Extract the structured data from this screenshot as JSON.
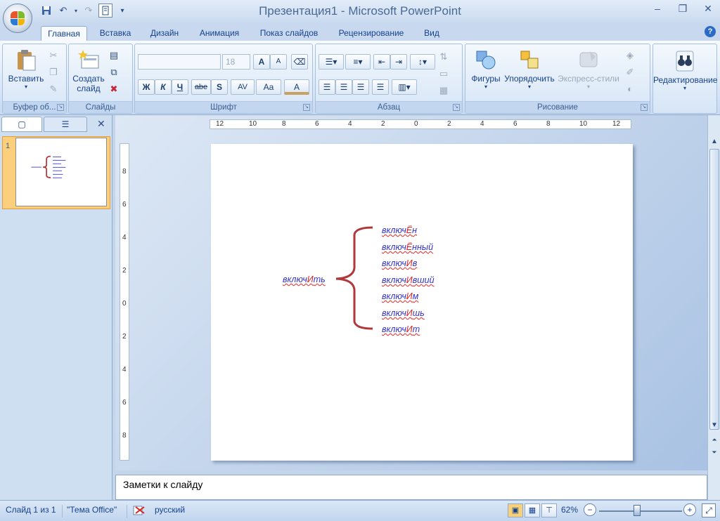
{
  "window": {
    "title": "Презентация1 - Microsoft PowerPoint",
    "minimize": "–",
    "restore": "❐",
    "close": "✕"
  },
  "quick_access": {
    "save_icon": "save-icon",
    "undo_icon": "undo-icon",
    "redo_icon": "redo-icon",
    "customize_icon": "customize-icon"
  },
  "tabs": [
    {
      "label": "Главная",
      "active": true
    },
    {
      "label": "Вставка"
    },
    {
      "label": "Дизайн"
    },
    {
      "label": "Анимация"
    },
    {
      "label": "Показ слайдов"
    },
    {
      "label": "Рецензирование"
    },
    {
      "label": "Вид"
    }
  ],
  "ribbon": {
    "clipboard": {
      "label": "Буфер об...",
      "paste": "Вставить"
    },
    "slides": {
      "label": "Слайды",
      "new_slide_line1": "Создать",
      "new_slide_line2": "слайд"
    },
    "font": {
      "label": "Шрифт",
      "font_name": "",
      "font_size": "18",
      "grow": "A",
      "shrink": "A",
      "bold": "Ж",
      "italic": "К",
      "underline": "Ч",
      "strike": "abe",
      "shadow": "S",
      "spacing": "AV",
      "case": "Aa",
      "color": "A"
    },
    "paragraph": {
      "label": "Абзац"
    },
    "drawing": {
      "label": "Рисование",
      "shapes": "Фигуры",
      "arrange": "Упорядочить",
      "quick_styles": "Экспресс-стили"
    },
    "editing": {
      "label": "Редактирование"
    }
  },
  "left_panel": {
    "slide_number": "1",
    "close": "✕"
  },
  "ruler": {
    "h_ticks": [
      "12",
      "10",
      "8",
      "6",
      "4",
      "2",
      "0",
      "2",
      "4",
      "6",
      "8",
      "10",
      "12"
    ],
    "v_ticks": [
      "8",
      "6",
      "4",
      "2",
      "0",
      "2",
      "4",
      "6",
      "8"
    ]
  },
  "slide": {
    "root_word": {
      "stem": "включ",
      "accent": "И",
      "ending": "ть"
    },
    "forms": [
      {
        "stem": "включ",
        "accent": "Ё",
        "ending": "н"
      },
      {
        "stem": "включ",
        "accent": "Ё",
        "ending": "нный"
      },
      {
        "stem": "включ",
        "accent": "И",
        "ending": "в"
      },
      {
        "stem": "включ",
        "accent": "И",
        "ending": "вший"
      },
      {
        "stem": "включ",
        "accent": "И",
        "ending": "м"
      },
      {
        "stem": "включ",
        "accent": "И",
        "ending": "шь"
      },
      {
        "stem": "включ",
        "accent": "И",
        "ending": "т"
      }
    ],
    "brace_color": "#b0383a",
    "text_color": "#3333cc",
    "accent_color": "#e51b1b"
  },
  "notes": {
    "placeholder": "Заметки к слайду"
  },
  "status": {
    "slide_info": "Слайд 1 из 1",
    "theme": "\"Тема Office\"",
    "language": "русский",
    "zoom": "62%",
    "zoom_level": 0.45
  }
}
